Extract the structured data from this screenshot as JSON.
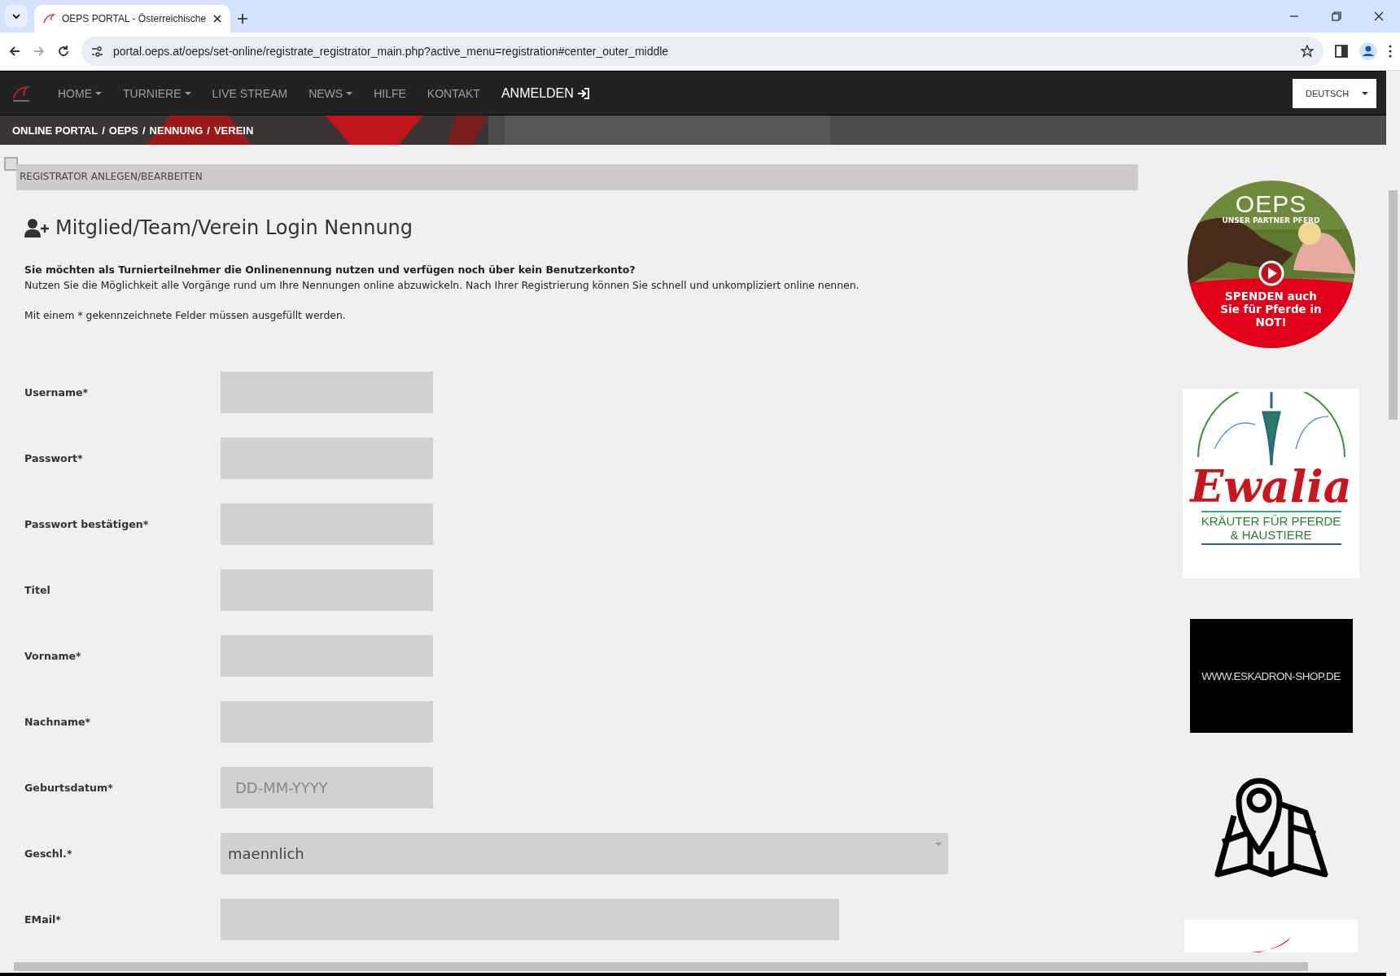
{
  "browser": {
    "tabs": [
      {
        "title": "OEPS PORTAL - Österreichische",
        "selected": true
      }
    ],
    "url": "portal.oeps.at/oeps/set-online/registrate_registrator_main.php?active_menu=registration#center_outer_middle"
  },
  "navbar": {
    "items": [
      {
        "label": "HOME",
        "kind": "menu",
        "dropdown": true
      },
      {
        "label": "TURNIERE",
        "kind": "menu",
        "dropdown": true
      },
      {
        "label": "LIVE STREAM",
        "kind": "menu",
        "dropdown": false
      },
      {
        "label": "NEWS",
        "kind": "menu",
        "dropdown": true
      },
      {
        "label": "HILFE",
        "kind": "menu",
        "dropdown": false
      },
      {
        "label": "KONTAKT",
        "kind": "menu",
        "dropdown": false
      },
      {
        "label": "ANMELDEN",
        "kind": "login",
        "dropdown": false
      }
    ],
    "language": "DEUTSCH"
  },
  "breadcrumb": {
    "separator": "/",
    "items": [
      "ONLINE PORTAL",
      "OEPS",
      "NENNUNG",
      "VEREIN"
    ]
  },
  "toggle": {
    "checked": false
  },
  "panel_title": "REGISTRATOR ANLEGEN/BEARBEITEN",
  "heading": "Mitglied/Team/Verein Login Nennung",
  "intro": {
    "question": "Sie möchten als Turnierteilnehmer die Onlinenennung nutzen und verfügen noch über kein Benutzerkonto?",
    "text": "Nutzen Sie die Möglichkeit alle Vorgänge rund um Ihre Nennungen online abzuwickeln. Nach Ihrer Registrierung können Sie schnell und unkompliziert online nennen.",
    "note": "Mit einem * gekennzeichnete Felder müssen ausgefüllt werden."
  },
  "form": [
    {
      "label": "Username*",
      "kind": "text"
    },
    {
      "label": "Passwort*",
      "kind": "password"
    },
    {
      "label": "Passwort bestätigen*",
      "kind": "password"
    },
    {
      "label": "Titel",
      "kind": "text"
    },
    {
      "label": "Vorname*",
      "kind": "text"
    },
    {
      "label": "Nachname*",
      "kind": "text"
    },
    {
      "label": "Geburtsdatum*",
      "kind": "date",
      "placeholder": "DD-MM-YYYY"
    },
    {
      "label": "Geschl.*",
      "kind": "select",
      "value": "maennlich"
    },
    {
      "label": "EMail*",
      "kind": "email"
    }
  ],
  "sidebar": [
    {
      "kind": "donation",
      "logo": "OEPS",
      "tagline": "UNSER PARTNER PFERD",
      "text": "SPENDEN auch Sie für Pferde in NOT!"
    },
    {
      "kind": "brand",
      "name": "Ewalia",
      "tagline": "KRÄUTER FÜR PFERDE & HAUSTIERE"
    },
    {
      "kind": "shop",
      "text": "WWW.ESKADRON-SHOP.DE"
    },
    {
      "kind": "map"
    },
    {
      "kind": "partial"
    }
  ]
}
